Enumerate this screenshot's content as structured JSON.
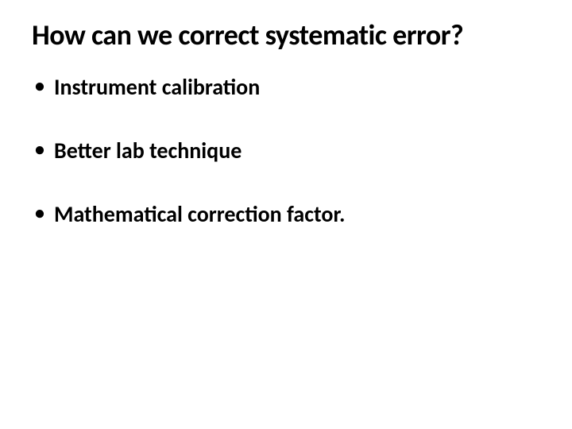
{
  "slide": {
    "title": "How can we correct systematic error?",
    "bullets": [
      "Instrument calibration",
      "Better lab technique",
      "Mathematical correction factor."
    ]
  }
}
